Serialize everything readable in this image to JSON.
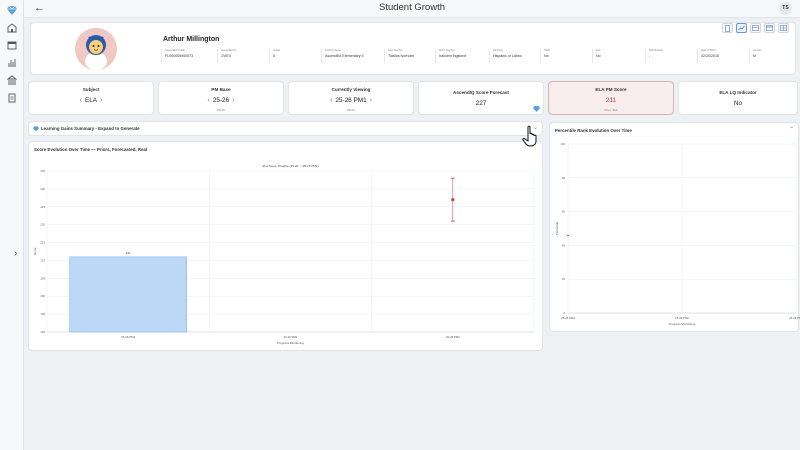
{
  "header": {
    "title": "Student Growth",
    "user_initials": "TS"
  },
  "sidebar": {
    "icons": [
      "gem-icon",
      "school-icon",
      "calendar-icon",
      "stats-icon",
      "bank-icon",
      "report-icon"
    ]
  },
  "profile": {
    "name": "Arthur Millington",
    "fields": [
      {
        "label": "AscendEd FLEID",
        "value": "FL000005900073"
      },
      {
        "label": "AscendEd ID",
        "value": "1VIEX"
      },
      {
        "label": "Grade",
        "value": "5"
      },
      {
        "label": "School Name",
        "value": "AscendEd Elementary II"
      },
      {
        "label": "ELA Teacher",
        "value": "Tiashia Ivorholm"
      },
      {
        "label": "Math Teacher",
        "value": "Iralowm Ingstone"
      },
      {
        "label": "Ethnicity",
        "value": "Hispanic or Latino"
      },
      {
        "label": "SWD",
        "value": "No"
      },
      {
        "label": "ELL",
        "value": "No"
      },
      {
        "label": "504/ID Data",
        "value": "-"
      },
      {
        "label": "Date of Birth",
        "value": "02/20/2015"
      },
      {
        "label": "Gender",
        "value": "M"
      }
    ]
  },
  "stats": {
    "subject": {
      "title": "Subject",
      "value": "ELA"
    },
    "pm_base": {
      "title": "PM Base",
      "value": "25-26",
      "sub": "25-26"
    },
    "viewing": {
      "title": "Currently Viewing",
      "value": "25-26 PM1",
      "sub": "25-26"
    },
    "forecast": {
      "title": "AscendIQ Score Forecast",
      "value": "227"
    },
    "pm_score": {
      "title": "ELA PM Score",
      "value": "211",
      "sub": "Prior: 214"
    },
    "lq": {
      "title": "ELA LQ Indicator",
      "value": "No"
    }
  },
  "gains": {
    "label": "Learning Gains Summary - Expand to Generate"
  },
  "score_panel": {
    "title": "Score Evolution Over Time — Priors, Forecasted, Real"
  },
  "pct_panel": {
    "title": "Percentile Rank Evolution Over Time"
  },
  "colors": {
    "bar_fill": "#bcd8f6",
    "bar_stroke": "#6fa7e0",
    "forecast": "#d23a3a",
    "highlight_bg": "#f7eded"
  },
  "chart_data": [
    {
      "type": "bar",
      "title": "ELA Score Timeline (25-26 → 25-26 PM1)",
      "xlabel": "Progress Monitoring",
      "ylabel": "Score",
      "categories": [
        "25-26 PM1",
        "25-26 PM2",
        "25-26 PM3"
      ],
      "values": [
        211,
        null,
        null
      ],
      "data_labels": [
        "211",
        "",
        ""
      ],
      "forecast": {
        "category": "25-26 PM3",
        "value": 227,
        "upper": 233,
        "lower": 221
      },
      "yticks": [
        190,
        195,
        200,
        205,
        210,
        215,
        220,
        225,
        230,
        235
      ],
      "ylim": [
        190,
        235
      ],
      "grid": true
    },
    {
      "type": "line",
      "title": "",
      "xlabel": "Progress Monitoring",
      "ylabel": "Percentile",
      "categories": [
        "25-26 PM1",
        "25-26 PM2",
        "25-26 PM3"
      ],
      "values": [
        46,
        null,
        null
      ],
      "yticks": [
        0,
        20,
        40,
        60,
        80,
        100
      ],
      "ylim": [
        0,
        100
      ],
      "grid": true
    }
  ]
}
